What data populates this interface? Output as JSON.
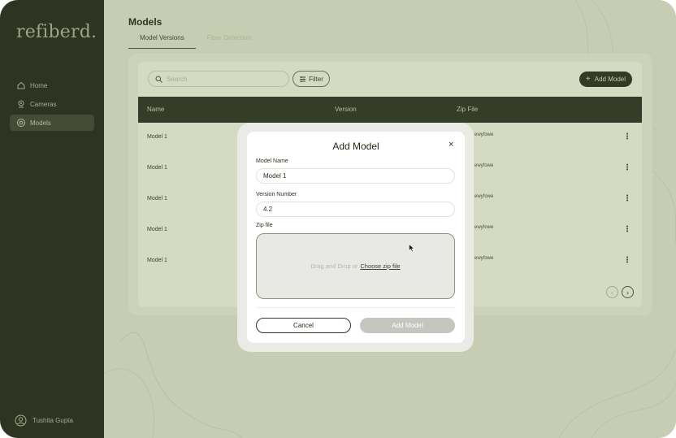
{
  "app": {
    "logo": "refiberd."
  },
  "sidebar": {
    "items": [
      {
        "label": "Home",
        "icon": "home-icon",
        "active": false
      },
      {
        "label": "Cameras",
        "icon": "camera-icon",
        "active": false
      },
      {
        "label": "Models",
        "icon": "models-icon",
        "active": true
      }
    ],
    "user": {
      "name": "Tushita Gupta",
      "icon": "user-icon"
    }
  },
  "main": {
    "title": "Models",
    "tabs": [
      {
        "label": "Model Versions",
        "active": true
      },
      {
        "label": "Fiber Detection",
        "active": false
      }
    ],
    "toolbar": {
      "search_placeholder": "Search",
      "filter_label": "Filter",
      "add_model_label": "Add Model"
    },
    "table": {
      "columns": [
        "Name",
        "Version",
        "Zip File"
      ],
      "rows": [
        {
          "name": "Model 1",
          "zip": "ewyfowe",
          "more": "⋮"
        },
        {
          "name": "Model 1",
          "zip": "ewyfowe",
          "more": "⋮"
        },
        {
          "name": "Model 1",
          "zip": "ewyfowe",
          "more": "⋮"
        },
        {
          "name": "Model 1",
          "zip": "ewyfowe",
          "more": "⋮"
        },
        {
          "name": "Model 1",
          "zip": "ewyfowe",
          "more": "⋮"
        }
      ]
    },
    "pager": {
      "prev": "‹",
      "next": "›"
    }
  },
  "modal": {
    "title": "Add Model",
    "close": "×",
    "fields": {
      "model_name": {
        "label": "Model Name",
        "value": "Model 1"
      },
      "version_number": {
        "label": "Version Number",
        "value": "4.2"
      },
      "zip_file": {
        "label": "Zip file",
        "hint": "Drag and Drop or",
        "link": "Choose zip file"
      }
    },
    "cancel_label": "Cancel",
    "submit_label": "Add Model"
  },
  "colors": {
    "sidebar_bg": "#2d3421",
    "accent_dark": "#333a26",
    "overlay": "#c7cdb2",
    "modal_bg": "#ffffff",
    "disabled_button": "#c5c6c1"
  }
}
